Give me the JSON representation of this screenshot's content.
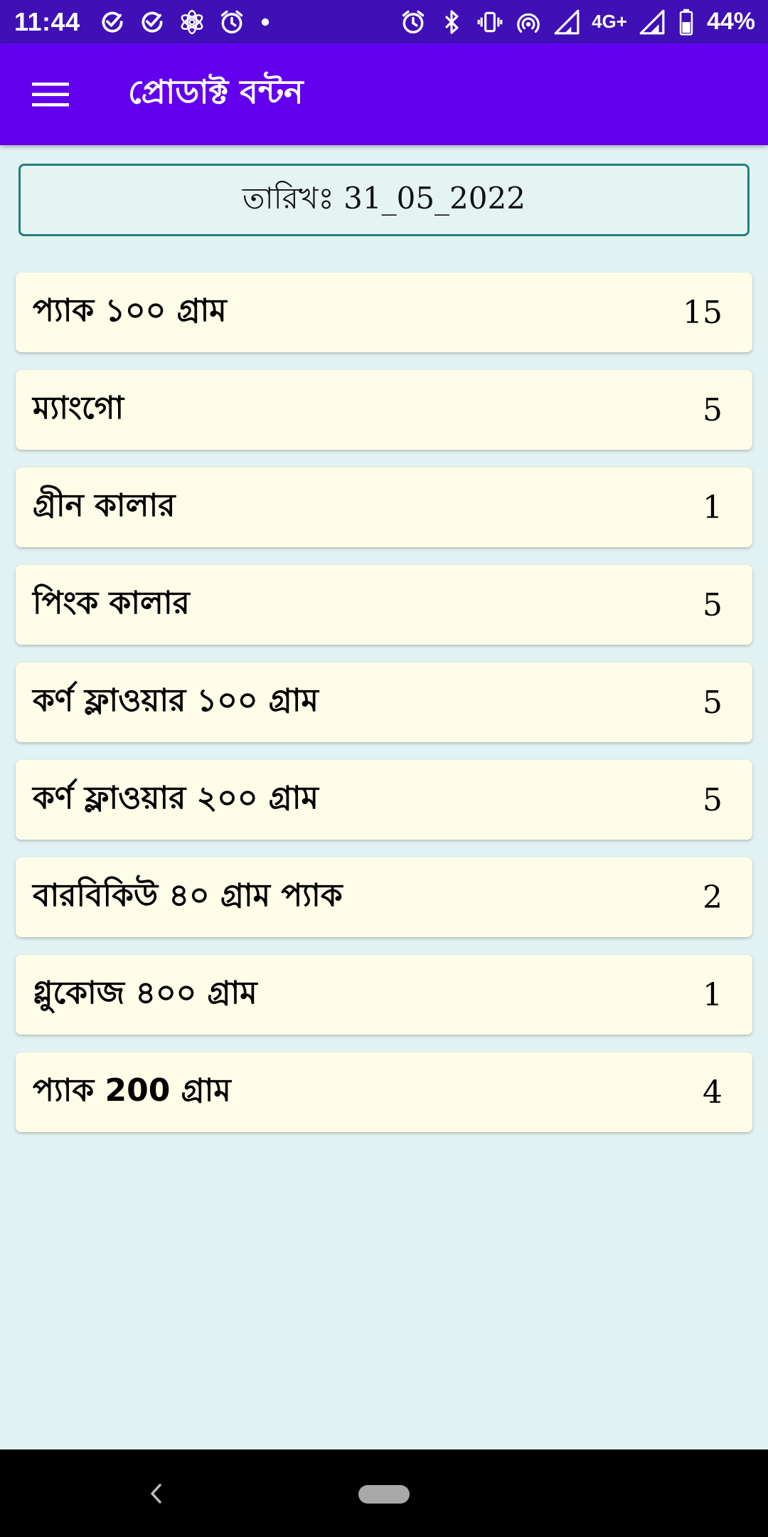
{
  "status_bar": {
    "time": "11:44",
    "left_icons": [
      "check-circle-icon",
      "check-circle-icon",
      "settings-flower-icon",
      "alarm-icon",
      "dot-icon"
    ],
    "right_icons": [
      "alarm-icon",
      "bluetooth-icon",
      "vibrate-icon",
      "hotspot-icon",
      "signal-icon",
      "signal-icon",
      "battery-icon"
    ],
    "network": "4G+",
    "battery": "44%"
  },
  "app_bar": {
    "title": "প্রোডাক্ট বন্টন",
    "menu_icon": "hamburger-menu-icon"
  },
  "date": {
    "text": "তারিখঃ 31_05_2022"
  },
  "products": [
    {
      "name": "প্যাক ১০০ গ্রাম",
      "qty": "15"
    },
    {
      "name": "ম্যাংগো",
      "qty": "5"
    },
    {
      "name": "গ্রীন কালার",
      "qty": "1"
    },
    {
      "name": "পিংক কালার",
      "qty": "5"
    },
    {
      "name": "কর্ণ ফ্লাওয়ার ১০০ গ্রাম",
      "qty": "5"
    },
    {
      "name": "কর্ণ ফ্লাওয়ার ২০০ গ্রাম",
      "qty": "5"
    },
    {
      "name": "বারবিকিউ ৪০ গ্রাম প্যাক",
      "qty": "2"
    },
    {
      "name": "গ্লুকোজ ৪০০ গ্রাম",
      "qty": "1"
    },
    {
      "name": "প্যাক 200 গ্রাম",
      "qty": "4"
    }
  ],
  "nav_bar": {
    "back_icon": "back-chevron-icon",
    "home_icon": "home-pill-icon"
  },
  "colors": {
    "status_bar": "#3f10b5",
    "app_bar": "#6200ee",
    "background": "#e2f2f2",
    "card": "#fffde8",
    "date_border": "#1f7f78"
  }
}
